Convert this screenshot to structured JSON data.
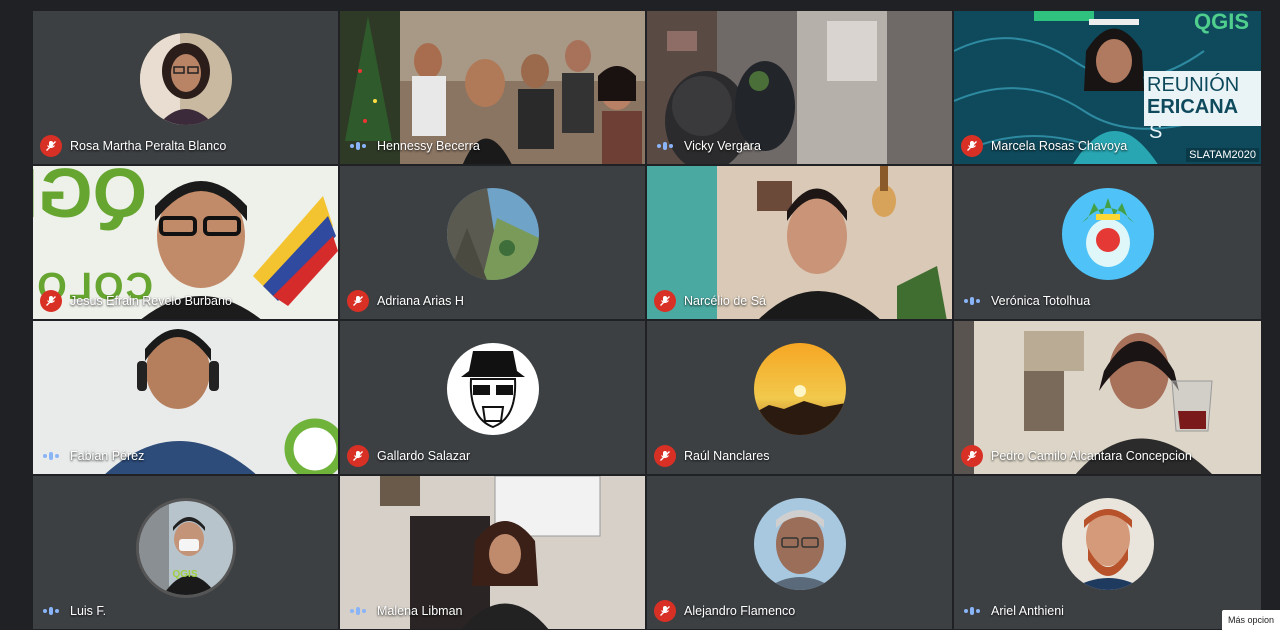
{
  "participants": [
    {
      "name": "Rosa Martha Peralta Blanco",
      "muted": true
    },
    {
      "name": "Hennessy Becerra",
      "muted": false
    },
    {
      "name": "Vicky Vergara",
      "muted": false
    },
    {
      "name": "Marcela Rosas Chavoya",
      "muted": true
    },
    {
      "name": "Jesus Efrain Revelo Burbano",
      "muted": true
    },
    {
      "name": "Adriana Arias H",
      "muted": true
    },
    {
      "name": "Narcélio de Sá",
      "muted": true
    },
    {
      "name": "Verónica Totolhua",
      "muted": false
    },
    {
      "name": "Fabian Pérez",
      "muted": false
    },
    {
      "name": "Gallardo Salazar",
      "muted": true
    },
    {
      "name": "Raúl Nanclares",
      "muted": true
    },
    {
      "name": "Pedro Camilo Alcantara Concepcion",
      "muted": true
    },
    {
      "name": "Luis F.",
      "muted": false
    },
    {
      "name": "Malena Libman",
      "muted": false
    },
    {
      "name": "Alejandro Flamenco",
      "muted": true
    },
    {
      "name": "Ariel Anthieni",
      "muted": false
    }
  ],
  "backgrounds": {
    "marcela_banner": {
      "logo": "QGIS",
      "line1": "REUNIÓN",
      "line2": "ERICANA",
      "line3": "S",
      "tag": "SLATAM2020"
    },
    "jesus_banner": {
      "logo": "QGIS",
      "word": "COLOMBIA"
    },
    "fabian_banner": {
      "logo": "Q"
    },
    "luis_shirt": {
      "logo": "QGIS"
    }
  },
  "more_options_label": "Más opcion",
  "colors": {
    "mute_red": "#d93025",
    "speaking_blue": "#8ab4f8",
    "tile_bg": "#3c4043"
  }
}
